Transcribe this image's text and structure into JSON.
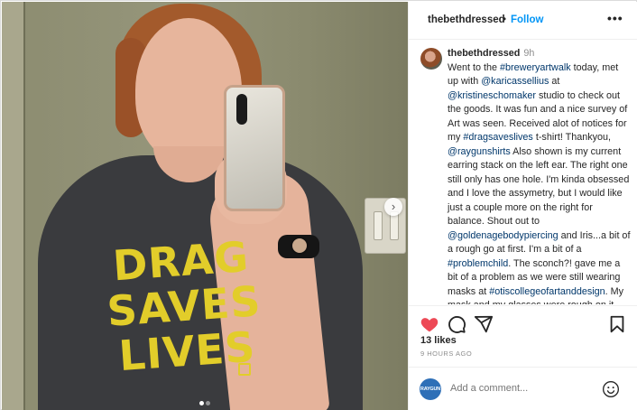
{
  "post": {
    "username": "thebethdressed",
    "separator": "•",
    "follow_label": "Follow",
    "more_label": "•••"
  },
  "photo": {
    "shirt_line1": "DRAG",
    "shirt_line2": "SAVES",
    "shirt_line3": "LIVES",
    "next_arrow": "›",
    "carousel_index": 1,
    "carousel_count": 2
  },
  "caption": {
    "username": "thebethdressed",
    "time": "9h",
    "t1": "Went to the ",
    "link1": "#breweryartwalk",
    "t2": " today, met up with ",
    "link2": "@karicassellius",
    "t3": " at ",
    "link3": "@kristineschomaker",
    "t4": " studio to check out the goods. It was fun and a nice survey of Art was seen. Received alot of notices for my ",
    "link4": "#dragsaveslives",
    "t5": " t-shirt! Thankyou, ",
    "link5": "@raygunshirts",
    "t6": " Also shown is my current earring stack on the left ear. The right one still only has one hole. I'm kinda obsessed and I love the assymetry, but I would like just a couple more on the right for balance. Shout out to ",
    "link6": "@goldenagebodypiercing",
    "t7": " and Iris...a bit of a rough go at first. I'm a bit of a ",
    "link7": "#problemchild",
    "t8": ". The sconch?! gave me a bit of a problem as we were still wearing masks at ",
    "link8": "#otiscollegeofartanddesign",
    "t9": ". My mask and my glasses were rough on it and it bled quite badly. We don't wear masks now ....but I started cutting off"
  },
  "actions": {
    "like_icon": "heart-filled-icon",
    "comment_icon": "comment-icon",
    "share_icon": "send-icon",
    "save_icon": "bookmark-icon",
    "like_color": "#ed4956",
    "likes": "13 likes",
    "time_ago": "9 HOURS AGO"
  },
  "comment": {
    "avatar_label": "RAYGUN",
    "placeholder": "Add a comment...",
    "emoji_icon": "smiley-icon"
  },
  "colors": {
    "link": "#00376b",
    "follow": "#0095f6",
    "shirt_print": "#e2cd2a"
  }
}
